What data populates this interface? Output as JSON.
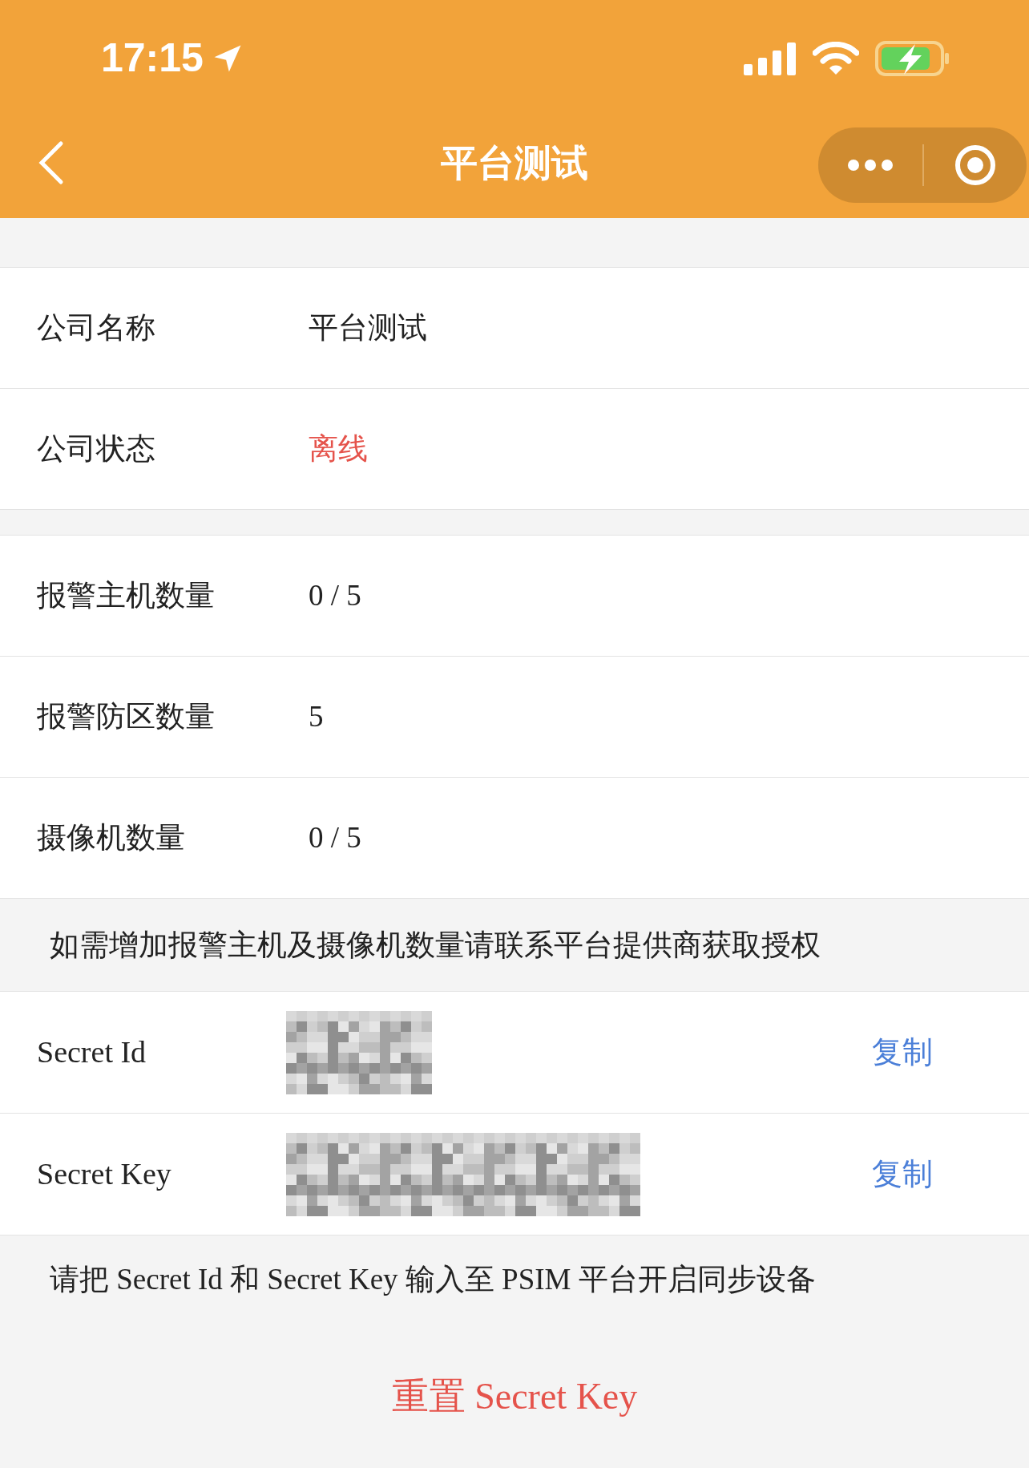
{
  "status_bar": {
    "time": "17:15"
  },
  "nav": {
    "title": "平台测试"
  },
  "sections": [
    {
      "rows": [
        {
          "label": "公司名称",
          "value": "平台测试"
        },
        {
          "label": "公司状态",
          "value": "离线",
          "color": "#e5534b"
        }
      ]
    },
    {
      "rows": [
        {
          "label": "报警主机数量",
          "value": "0 / 5"
        },
        {
          "label": "报警防区数量",
          "value": "5"
        },
        {
          "label": "摄像机数量",
          "value": "0 / 5"
        }
      ]
    }
  ],
  "quota_notice": "如需增加报警主机及摄像机数量请联系平台提供商获取授权",
  "secrets": [
    {
      "label": "Secret Id",
      "copy": "复制"
    },
    {
      "label": "Secret Key",
      "copy": "复制"
    }
  ],
  "sync_notice": "请把 Secret Id 和 Secret Key 输入至 PSIM 平台开启同步设备",
  "reset_button": "重置 Secret Key"
}
